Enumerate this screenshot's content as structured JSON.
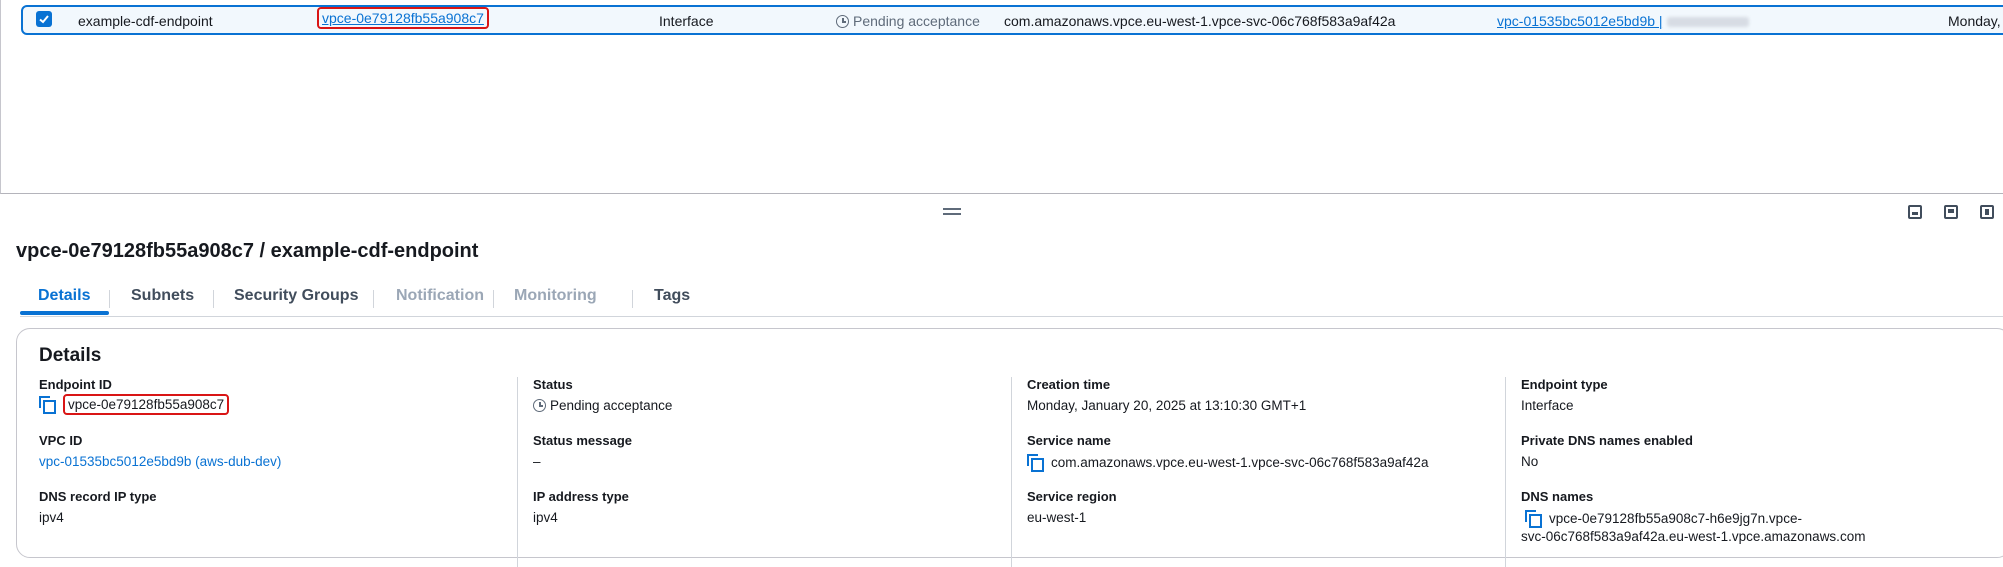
{
  "table": {
    "row": {
      "name": "example-cdf-endpoint",
      "endpoint_id": "vpce-0e79128fb55a908c7",
      "type": "Interface",
      "status": "Pending acceptance",
      "service_name": "com.amazonaws.vpce.eu-west-1.vpce-svc-06c768f583a9af42a",
      "vpc_id": "vpc-01535bc5012e5bd9b |",
      "creation_time": "Monday,"
    }
  },
  "panel": {
    "title": "vpce-0e79128fb55a908c7 / example-cdf-endpoint",
    "tabs": [
      {
        "label": "Details"
      },
      {
        "label": "Subnets"
      },
      {
        "label": "Security Groups"
      },
      {
        "label": "Notification"
      },
      {
        "label": "Monitoring"
      },
      {
        "label": "Tags"
      }
    ]
  },
  "details": {
    "heading": "Details",
    "endpoint_id_label": "Endpoint ID",
    "endpoint_id": "vpce-0e79128fb55a908c7",
    "vpc_id_label": "VPC ID",
    "vpc_id": "vpc-01535bc5012e5bd9b (aws-dub-dev)",
    "dns_record_ip_type_label": "DNS record IP type",
    "dns_record_ip_type": "ipv4",
    "status_label": "Status",
    "status": "Pending acceptance",
    "status_message_label": "Status message",
    "status_message": "–",
    "ip_address_type_label": "IP address type",
    "ip_address_type": "ipv4",
    "creation_time_label": "Creation time",
    "creation_time": "Monday, January 20, 2025 at 13:10:30 GMT+1",
    "service_name_label": "Service name",
    "service_name": "com.amazonaws.vpce.eu-west-1.vpce-svc-06c768f583a9af42a",
    "service_region_label": "Service region",
    "service_region": "eu-west-1",
    "endpoint_type_label": "Endpoint type",
    "endpoint_type": "Interface",
    "private_dns_label": "Private DNS names enabled",
    "private_dns": "No",
    "dns_names_label": "DNS names",
    "dns_names_line1": "vpce-0e79128fb55a908c7-h6e9jg7n.vpce-",
    "dns_names_line2": "svc-06c768f583a9af42a.eu-west-1.vpce.amazonaws.com"
  },
  "colors": {
    "accent": "#0972d3",
    "highlight": "#d91515",
    "selected_row_bg": "#f2f8fd"
  }
}
